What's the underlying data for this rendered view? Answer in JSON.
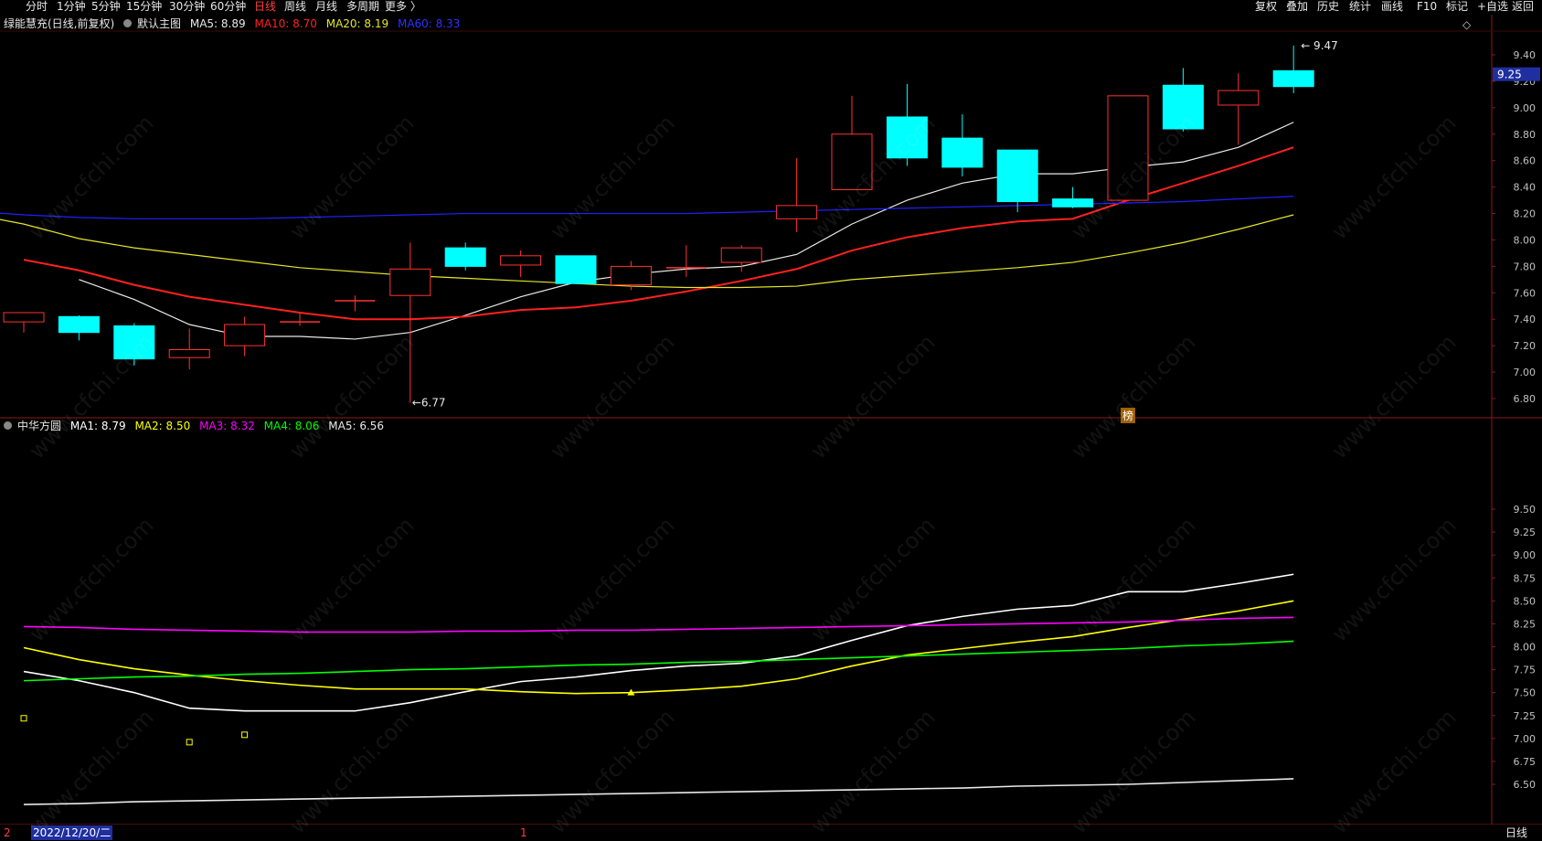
{
  "toolbar": {
    "left": [
      "分时",
      "1分钟",
      "5分钟",
      "15分钟",
      "30分钟",
      "60分钟",
      "日线",
      "周线",
      "月线",
      "多周期",
      "更多 〉"
    ],
    "active": "日线",
    "right": [
      "复权",
      "叠加",
      "历史",
      "统计",
      "画线",
      "F10",
      "标记",
      "+自选",
      "返回"
    ]
  },
  "main_info": {
    "stock": "绿能慧充(日线,前复权)",
    "indicator": "默认主图",
    "ma5": "MA5: 8.89",
    "ma10": "MA10: 8.70",
    "ma20": "MA20: 8.19",
    "ma60": "MA60: 8.33"
  },
  "sub_info": {
    "indicator": "中华方圆",
    "ma1": "MA1: 8.79",
    "ma2": "MA2: 8.50",
    "ma3": "MA3: 8.32",
    "ma4": "MA4: 8.06",
    "ma5": "MA5: 6.56"
  },
  "annotations": {
    "high": "9.47",
    "low": "6.77",
    "current_price": "9.25",
    "bang": "榜",
    "diamond": "◇"
  },
  "bottom": {
    "date": "2022/12/20/二",
    "period": "日线",
    "left_marker": "2",
    "mid_marker": "1"
  },
  "watermark": "www.cfchi.com",
  "colors": {
    "up": "#ff3232",
    "down": "#00ffff",
    "ma5": "#e8e8e8",
    "ma10": "#ff2020",
    "ma20": "#e6e62a",
    "ma60": "#2020ff",
    "sub_ma1": "#ffffff",
    "sub_ma2": "#ffff00",
    "sub_ma3": "#ff00ff",
    "sub_ma4": "#00ff00",
    "sub_ma5": "#e8e8e8"
  },
  "chart_data": [
    {
      "type": "candlestick",
      "title": "绿能慧充(日线,前复权)",
      "ylim": [
        6.7,
        9.55
      ],
      "yticks": [
        6.8,
        7.0,
        7.2,
        7.4,
        7.6,
        7.8,
        8.0,
        8.2,
        8.4,
        8.6,
        8.8,
        9.0,
        9.2,
        9.4
      ],
      "candles": [
        {
          "o": 7.38,
          "h": 7.45,
          "l": 7.3,
          "c": 7.45
        },
        {
          "o": 7.42,
          "h": 7.43,
          "l": 7.24,
          "c": 7.3
        },
        {
          "o": 7.35,
          "h": 7.37,
          "l": 7.05,
          "c": 7.1
        },
        {
          "o": 7.11,
          "h": 7.33,
          "l": 7.02,
          "c": 7.17
        },
        {
          "o": 7.2,
          "h": 7.42,
          "l": 7.12,
          "c": 7.36
        },
        {
          "o": 7.38,
          "h": 7.45,
          "l": 7.35,
          "c": 7.38
        },
        {
          "o": 7.54,
          "h": 7.58,
          "l": 7.46,
          "c": 7.54
        },
        {
          "o": 7.58,
          "h": 7.98,
          "l": 6.77,
          "c": 7.78
        },
        {
          "o": 7.94,
          "h": 7.98,
          "l": 7.77,
          "c": 7.8
        },
        {
          "o": 7.81,
          "h": 7.92,
          "l": 7.72,
          "c": 7.88
        },
        {
          "o": 7.88,
          "h": 7.88,
          "l": 7.67,
          "c": 7.67
        },
        {
          "o": 7.66,
          "h": 7.84,
          "l": 7.62,
          "c": 7.8
        },
        {
          "o": 7.79,
          "h": 7.96,
          "l": 7.72,
          "c": 7.79
        },
        {
          "o": 7.83,
          "h": 7.96,
          "l": 7.76,
          "c": 7.94
        },
        {
          "o": 8.16,
          "h": 8.62,
          "l": 8.06,
          "c": 8.26
        },
        {
          "o": 8.38,
          "h": 9.09,
          "l": 8.38,
          "c": 8.8
        },
        {
          "o": 8.93,
          "h": 9.18,
          "l": 8.56,
          "c": 8.62
        },
        {
          "o": 8.77,
          "h": 8.95,
          "l": 8.48,
          "c": 8.55
        },
        {
          "o": 8.68,
          "h": 8.68,
          "l": 8.21,
          "c": 8.29
        },
        {
          "o": 8.31,
          "h": 8.4,
          "l": 8.24,
          "c": 8.25
        },
        {
          "o": 8.3,
          "h": 9.09,
          "l": 8.3,
          "c": 9.09
        },
        {
          "o": 9.17,
          "h": 9.3,
          "l": 8.82,
          "c": 8.84
        },
        {
          "o": 9.02,
          "h": 9.26,
          "l": 8.72,
          "c": 9.13
        },
        {
          "o": 9.28,
          "h": 9.47,
          "l": 9.11,
          "c": 9.16
        }
      ],
      "series": [
        {
          "name": "MA5",
          "values": [
            7.7,
            7.55,
            7.36,
            7.27,
            7.27,
            7.25,
            7.3,
            7.43,
            7.57,
            7.68,
            7.74,
            7.78,
            7.8,
            7.89,
            8.12,
            8.3,
            8.43,
            8.5,
            8.5,
            8.55,
            8.59,
            8.7,
            8.89
          ]
        },
        {
          "name": "MA10",
          "values": [
            7.85,
            7.77,
            7.66,
            7.57,
            7.51,
            7.45,
            7.4,
            7.4,
            7.42,
            7.47,
            7.49,
            7.54,
            7.61,
            7.69,
            7.78,
            7.92,
            8.02,
            8.09,
            8.14,
            8.16,
            8.3,
            8.43,
            8.56,
            8.7
          ]
        },
        {
          "name": "MA20",
          "values": [
            8.2,
            8.12,
            8.01,
            7.94,
            7.89,
            7.84,
            7.79,
            7.76,
            7.73,
            7.71,
            7.69,
            7.67,
            7.65,
            7.64,
            7.64,
            7.65,
            7.7,
            7.73,
            7.76,
            7.79,
            7.83,
            7.9,
            7.98,
            8.08,
            8.19
          ]
        },
        {
          "name": "MA60",
          "values": [
            8.22,
            8.19,
            8.17,
            8.16,
            8.16,
            8.16,
            8.17,
            8.18,
            8.19,
            8.2,
            8.2,
            8.2,
            8.2,
            8.2,
            8.21,
            8.22,
            8.23,
            8.24,
            8.25,
            8.26,
            8.27,
            8.28,
            8.29,
            8.31,
            8.33
          ]
        }
      ]
    },
    {
      "type": "line",
      "title": "中华方圆",
      "ylim": [
        6.25,
        9.75
      ],
      "yticks": [
        6.5,
        6.75,
        7.0,
        7.25,
        7.5,
        7.75,
        8.0,
        8.25,
        8.5,
        8.75,
        9.0,
        9.25,
        9.5
      ],
      "series": [
        {
          "name": "MA1",
          "values": [
            7.73,
            7.63,
            7.5,
            7.33,
            7.3,
            7.3,
            7.3,
            7.39,
            7.51,
            7.62,
            7.67,
            7.74,
            7.79,
            7.82,
            7.9,
            8.07,
            8.23,
            8.33,
            8.41,
            8.45,
            8.6,
            8.6,
            8.69,
            8.79
          ]
        },
        {
          "name": "MA2",
          "values": [
            7.99,
            7.86,
            7.76,
            7.69,
            7.63,
            7.58,
            7.54,
            7.54,
            7.54,
            7.51,
            7.49,
            7.5,
            7.53,
            7.57,
            7.65,
            7.79,
            7.91,
            7.98,
            8.05,
            8.11,
            8.21,
            8.3,
            8.39,
            8.5
          ]
        },
        {
          "name": "MA3",
          "values": [
            8.22,
            8.21,
            8.19,
            8.18,
            8.17,
            8.16,
            8.16,
            8.16,
            8.17,
            8.17,
            8.18,
            8.18,
            8.19,
            8.2,
            8.21,
            8.22,
            8.23,
            8.24,
            8.25,
            8.26,
            8.27,
            8.29,
            8.31,
            8.32
          ]
        },
        {
          "name": "MA4",
          "values": [
            7.63,
            7.65,
            7.67,
            7.68,
            7.7,
            7.71,
            7.73,
            7.75,
            7.76,
            7.78,
            7.8,
            7.81,
            7.83,
            7.84,
            7.86,
            7.88,
            7.9,
            7.92,
            7.94,
            7.96,
            7.98,
            8.01,
            8.03,
            8.06
          ]
        },
        {
          "name": "MA5",
          "values": [
            6.28,
            6.29,
            6.31,
            6.32,
            6.33,
            6.34,
            6.35,
            6.36,
            6.37,
            6.38,
            6.39,
            6.4,
            6.41,
            6.42,
            6.43,
            6.44,
            6.45,
            6.46,
            6.48,
            6.49,
            6.5,
            6.52,
            6.54,
            6.56
          ]
        }
      ],
      "markers": [
        {
          "type": "square",
          "x": 0,
          "y": 7.22
        },
        {
          "type": "square",
          "x": 3,
          "y": 6.96
        },
        {
          "type": "square",
          "x": 4,
          "y": 7.04
        },
        {
          "type": "triangle",
          "x": 11,
          "y": 7.49
        }
      ]
    }
  ]
}
